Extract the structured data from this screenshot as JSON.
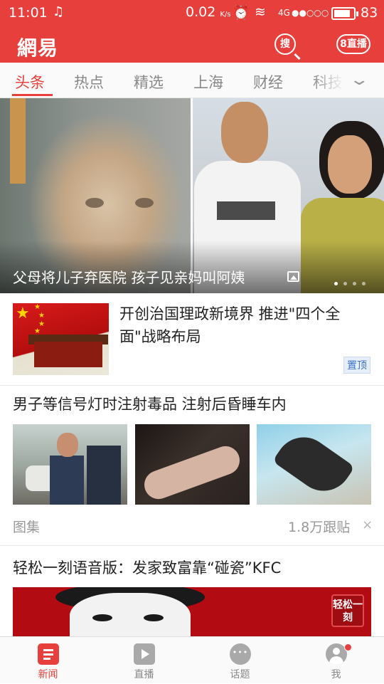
{
  "status_bar": {
    "time": "11:01",
    "speed": "0.02",
    "speed_unit": "K/s",
    "network": "4G",
    "signal_dots": "●●○○○",
    "battery": "83"
  },
  "header": {
    "logo": "網易",
    "search_label": "搜",
    "live_label": "直播",
    "live_prefix": "8"
  },
  "tabs": [
    "头条",
    "热点",
    "精选",
    "上海",
    "财经",
    "科技"
  ],
  "hero": {
    "caption": "父母将儿子弃医院 孩子见亲妈叫阿姨",
    "page_count": 4,
    "active_page": 0
  },
  "articles": [
    {
      "title": "开创治国理政新境界 推进\"四个全面\"战略布局",
      "badge": "置顶"
    },
    {
      "title": "男子等信号灯时注射毒品 注射后昏睡车内",
      "tag": "图集",
      "replies": "1.8万跟贴",
      "close": "×"
    },
    {
      "title": "轻松一刻语音版：发家致富靠“碰瓷”KFC",
      "image_badge": "轻松一刻"
    }
  ],
  "bottom_nav": [
    {
      "label": "新闻",
      "icon": "news-icon",
      "active": true
    },
    {
      "label": "直播",
      "icon": "play-icon",
      "active": false
    },
    {
      "label": "话题",
      "icon": "chat-bubble-icon",
      "active": false
    },
    {
      "label": "我",
      "icon": "user-icon",
      "active": false
    }
  ],
  "colors": {
    "brand_red": "#e7403c",
    "tab_inactive": "#888888",
    "badge_blue": "#3a73c5"
  }
}
